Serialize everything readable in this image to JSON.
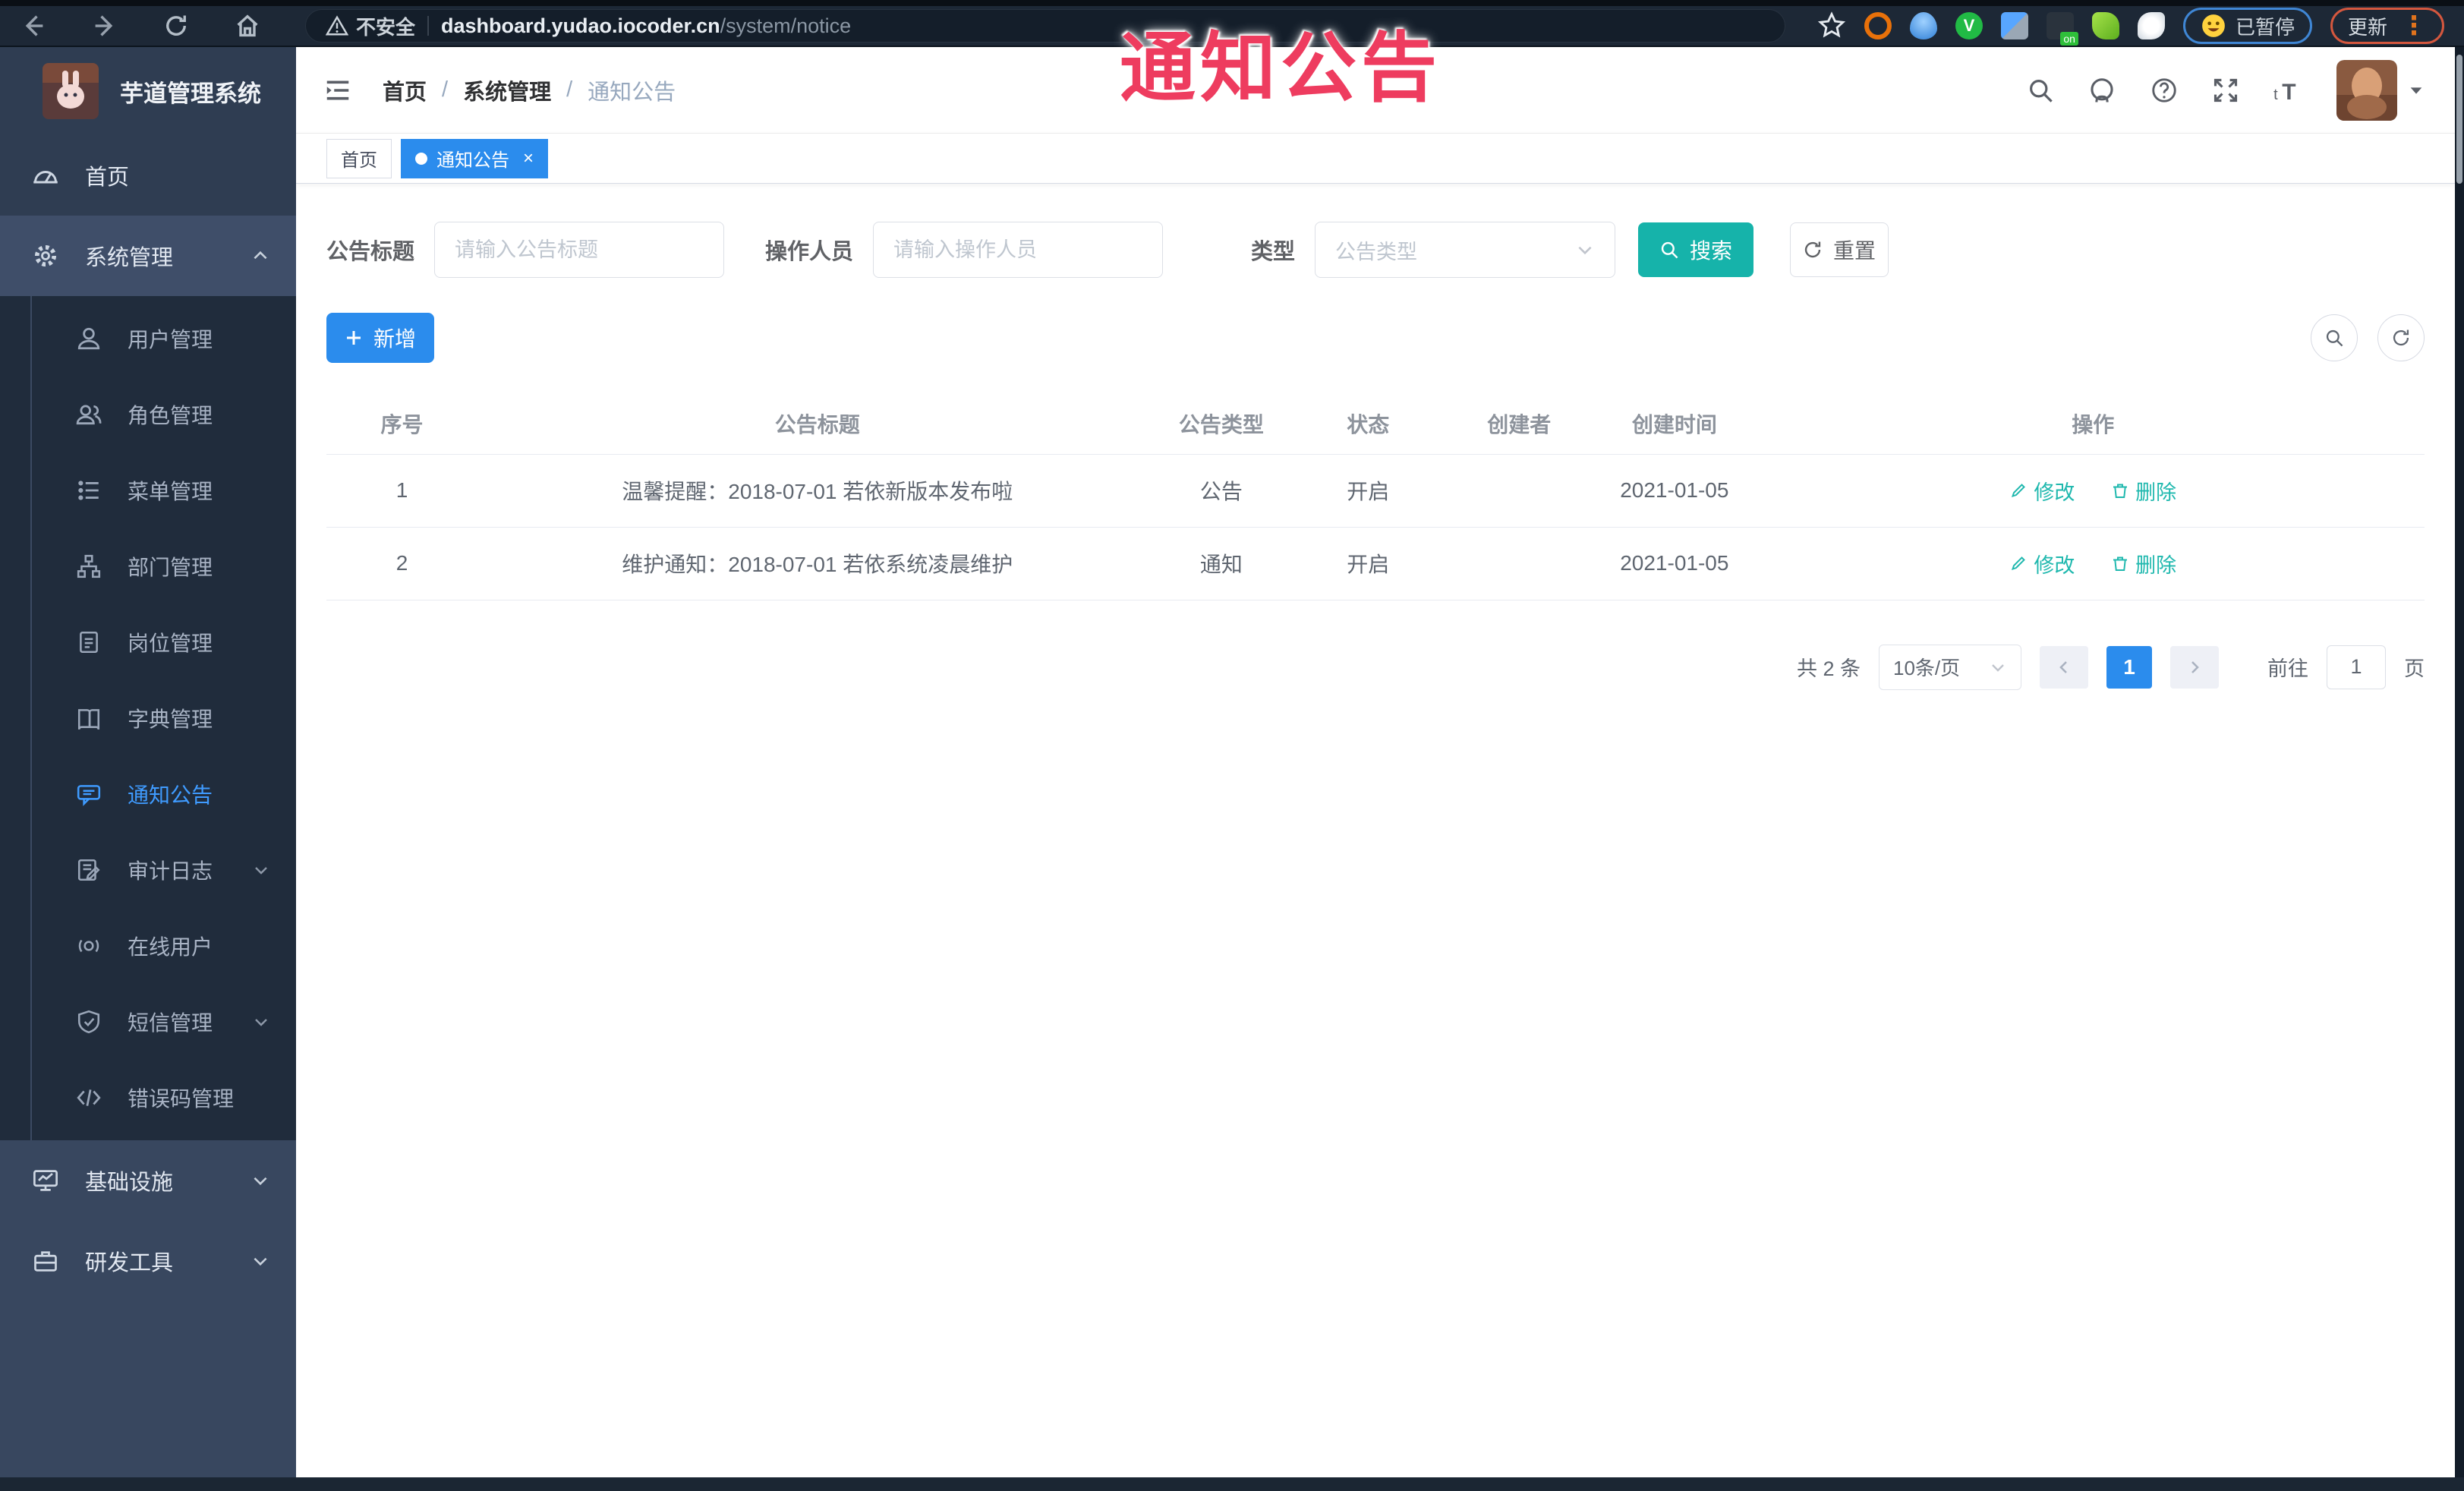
{
  "browser": {
    "security_label": "不安全",
    "url_host": "dashboard.yudao.iocoder.cn",
    "url_path": "/system/notice",
    "paused_badge": "已暂停",
    "update_button": "更新"
  },
  "annotation": {
    "text": "通知公告",
    "color": "#ee3c5f"
  },
  "sidebar": {
    "title": "芋道管理系统",
    "items": [
      {
        "label": "首页",
        "level": "root"
      },
      {
        "label": "系统管理",
        "level": "root",
        "expanded": true
      },
      {
        "label": "用户管理",
        "level": "sub"
      },
      {
        "label": "角色管理",
        "level": "sub"
      },
      {
        "label": "菜单管理",
        "level": "sub"
      },
      {
        "label": "部门管理",
        "level": "sub"
      },
      {
        "label": "岗位管理",
        "level": "sub"
      },
      {
        "label": "字典管理",
        "level": "sub"
      },
      {
        "label": "通知公告",
        "level": "sub",
        "active": true
      },
      {
        "label": "审计日志",
        "level": "sub",
        "collapsible": true
      },
      {
        "label": "在线用户",
        "level": "sub"
      },
      {
        "label": "短信管理",
        "level": "sub",
        "collapsible": true
      },
      {
        "label": "错误码管理",
        "level": "sub"
      },
      {
        "label": "基础设施",
        "level": "root",
        "collapsible": true
      },
      {
        "label": "研发工具",
        "level": "root",
        "collapsible": true
      }
    ]
  },
  "header": {
    "breadcrumb": [
      "首页",
      "系统管理",
      "通知公告"
    ],
    "separator": "/"
  },
  "tabs": [
    {
      "label": "首页",
      "active": false
    },
    {
      "label": "通知公告",
      "active": true,
      "close": "×"
    }
  ],
  "filters": {
    "title_label": "公告标题",
    "title_placeholder": "请输入公告标题",
    "operator_label": "操作人员",
    "operator_placeholder": "请输入操作人员",
    "type_label": "类型",
    "type_placeholder": "公告类型",
    "search_label": "搜索",
    "reset_label": "重置"
  },
  "toolbar": {
    "add_label": "新增"
  },
  "table": {
    "columns": [
      "序号",
      "公告标题",
      "公告类型",
      "状态",
      "创建者",
      "创建时间",
      "操作"
    ],
    "rows": [
      {
        "index": "1",
        "title": "温馨提醒：2018-07-01 若依新版本发布啦",
        "type": "公告",
        "status": "开启",
        "creator": "",
        "created_at": "2021-01-05"
      },
      {
        "index": "2",
        "title": "维护通知：2018-07-01 若依系统凌晨维护",
        "type": "通知",
        "status": "开启",
        "creator": "",
        "created_at": "2021-01-05"
      }
    ],
    "edit_label": "修改",
    "delete_label": "删除"
  },
  "pagination": {
    "total_text": "共 2 条",
    "page_size": "10条/页",
    "current_page": "1",
    "goto_label": "前往",
    "goto_value": "1",
    "page_label": "页"
  },
  "colors": {
    "primary_blue": "#2b8ced",
    "search_teal": "#16b3aa",
    "action_link_teal": "#1fb8ae",
    "annotation_red": "#ee3c5f",
    "active_menu_blue": "#3f9bff",
    "sidebar_bg": "#38475f",
    "submenu_bg": "#202c3c",
    "chrome_bg": "#1d2836"
  }
}
